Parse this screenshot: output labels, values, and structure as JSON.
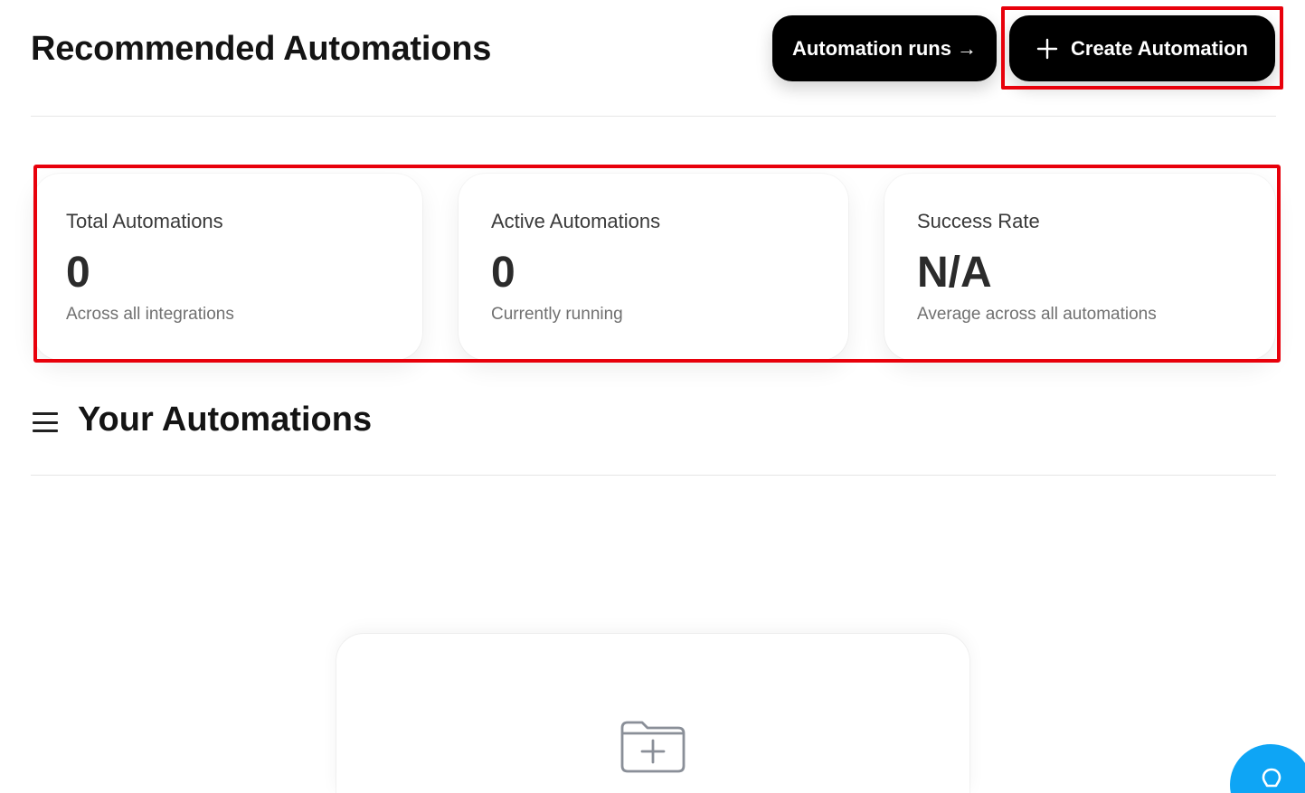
{
  "header": {
    "title": "Recommended Automations",
    "runs_button_label": "Automation runs →",
    "create_button_label": "Create Automation"
  },
  "stats": [
    {
      "label": "Total Automations",
      "value": "0",
      "sub": "Across all integrations"
    },
    {
      "label": "Active Automations",
      "value": "0",
      "sub": "Currently running"
    },
    {
      "label": "Success Rate",
      "value": "N/A",
      "sub": "Average across all automations"
    }
  ],
  "section": {
    "title": "Your Automations"
  },
  "icons": {
    "create": "plus-icon",
    "section": "menu-icon",
    "empty_state": "folder-plus-icon",
    "help": "lightbulb-icon"
  },
  "colors": {
    "button_bg": "#000000",
    "highlight": "#e8000b",
    "help_bubble": "#0ea5f5"
  }
}
